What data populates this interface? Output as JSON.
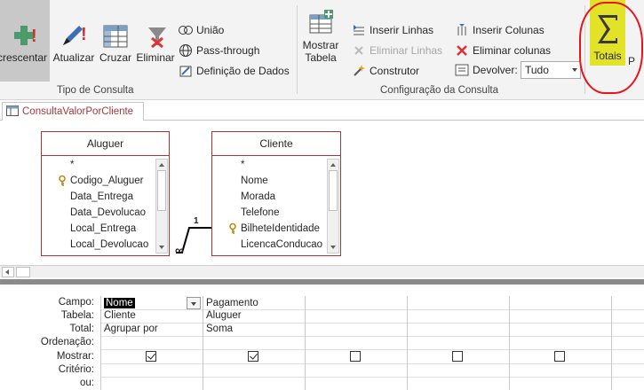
{
  "ribbon": {
    "buttons": {
      "acrescentar": "crescentar",
      "atualizar": "Atualizar",
      "cruzar": "Cruzar",
      "eliminar": "Eliminar",
      "mostrar_tabela_1": "Mostrar",
      "mostrar_tabela_2": "Tabela",
      "totais": "Totais",
      "p_cut": "P"
    },
    "small": {
      "uniao": "União",
      "passthrough": "Pass-through",
      "definicao": "Definição de Dados",
      "inserir_linhas": "Inserir Linhas",
      "eliminar_linhas": "Eliminar Linhas",
      "construtor": "Construtor",
      "inserir_colunas": "Inserir Colunas",
      "eliminar_colunas": "Eliminar colunas",
      "devolver": "Devolver:",
      "devolver_value": "Tudo"
    },
    "groups": {
      "tipo": "Tipo de Consulta",
      "config": "Configuração da Consulta"
    }
  },
  "tab": {
    "label": "ConsultaValorPorCliente"
  },
  "tables": {
    "aluguer": {
      "title": "Aluguer",
      "fields": [
        "*",
        "Codigo_Aluguer",
        "Data_Entrega",
        "Data_Devolucao",
        "Local_Entrega",
        "Local_Devolucao"
      ]
    },
    "cliente": {
      "title": "Cliente",
      "fields": [
        "*",
        "Nome",
        "Morada",
        "Telefone",
        "BilheteIdentidade",
        "LicencaConducao"
      ]
    },
    "relation": {
      "one": "1",
      "many": "∞"
    }
  },
  "grid": {
    "labels": {
      "campo": "Campo:",
      "tabela": "Tabela:",
      "total": "Total:",
      "ordenacao": "Ordenação:",
      "mostrar": "Mostrar:",
      "criterio": "Critério:",
      "ou": "ou:"
    },
    "columns": [
      {
        "campo": "Nome",
        "tabela": "Cliente",
        "total": "Agrupar por",
        "mostrar": true
      },
      {
        "campo": "Pagamento",
        "tabela": "Aluguer",
        "total": "Soma",
        "mostrar": true
      },
      {
        "campo": "",
        "tabela": "",
        "total": "",
        "mostrar": false
      },
      {
        "campo": "",
        "tabela": "",
        "total": "",
        "mostrar": false
      },
      {
        "campo": "",
        "tabela": "",
        "total": "",
        "mostrar": false
      }
    ]
  }
}
